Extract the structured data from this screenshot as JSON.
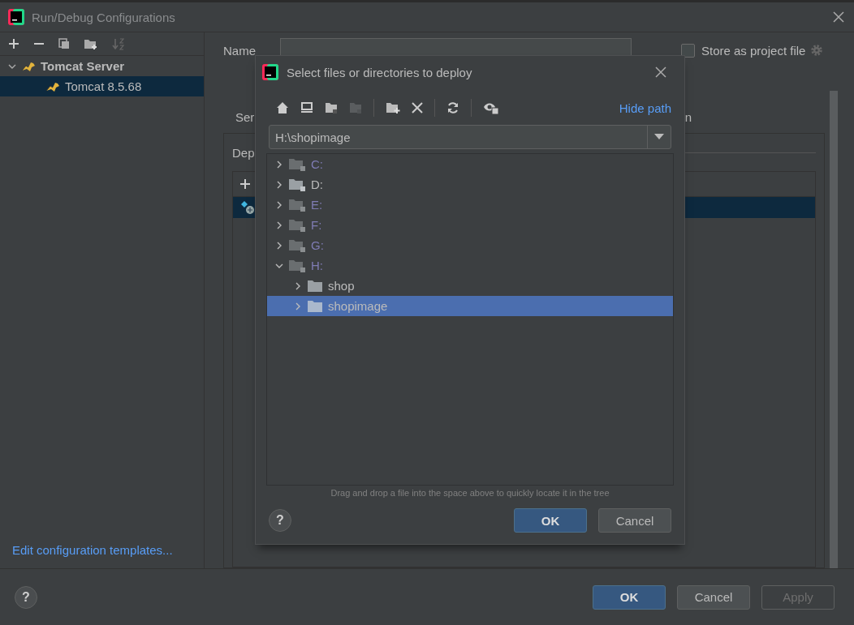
{
  "window": {
    "title": "Run/Debug Configurations"
  },
  "left_panel": {
    "tree": [
      {
        "label": "Tomcat Server",
        "expanded": true,
        "selected": false,
        "children": [
          {
            "label": "Tomcat 8.5.68",
            "selected": true
          }
        ]
      }
    ],
    "templates_link": "Edit configuration templates..."
  },
  "config": {
    "name_label": "Name",
    "store_as_project_file": {
      "label": "Store as project file",
      "checked": false
    },
    "tab_fragments": [
      "Ser",
      "n"
    ],
    "deployment_label": "Dep",
    "deployment_rows": [
      {
        "selected": true
      }
    ]
  },
  "help_button": "?",
  "buttons": [
    {
      "label": "OK",
      "kind": "primary",
      "disabled": false
    },
    {
      "label": "Cancel",
      "kind": "normal",
      "disabled": false
    },
    {
      "label": "Apply",
      "kind": "normal",
      "disabled": true
    }
  ],
  "deploy_dialog": {
    "title": "Select files or directories to deploy",
    "hide_path_link": "Hide path",
    "path": "H:\\shopimage",
    "tree": [
      {
        "label": "C:",
        "kind": "drive",
        "dimmed": true,
        "expanded": false,
        "selected": false
      },
      {
        "label": "D:",
        "kind": "drive",
        "dimmed": false,
        "expanded": false,
        "selected": false
      },
      {
        "label": "E:",
        "kind": "drive",
        "dimmed": true,
        "expanded": false,
        "selected": false
      },
      {
        "label": "F:",
        "kind": "drive",
        "dimmed": true,
        "expanded": false,
        "selected": false
      },
      {
        "label": "G:",
        "kind": "drive",
        "dimmed": true,
        "expanded": false,
        "selected": false
      },
      {
        "label": "H:",
        "kind": "drive",
        "dimmed": true,
        "expanded": true,
        "selected": false,
        "children": [
          {
            "label": "shop",
            "kind": "folder",
            "dimmed": false,
            "expanded": false,
            "selected": false
          },
          {
            "label": "shopimage",
            "kind": "folder",
            "dimmed": false,
            "expanded": false,
            "selected": true
          }
        ]
      }
    ],
    "hint": "Drag and drop a file into the space above to quickly locate it in the tree",
    "help_button": "?",
    "buttons": [
      {
        "label": "OK",
        "kind": "primary",
        "disabled": false
      },
      {
        "label": "Cancel",
        "kind": "normal",
        "disabled": false
      }
    ]
  }
}
